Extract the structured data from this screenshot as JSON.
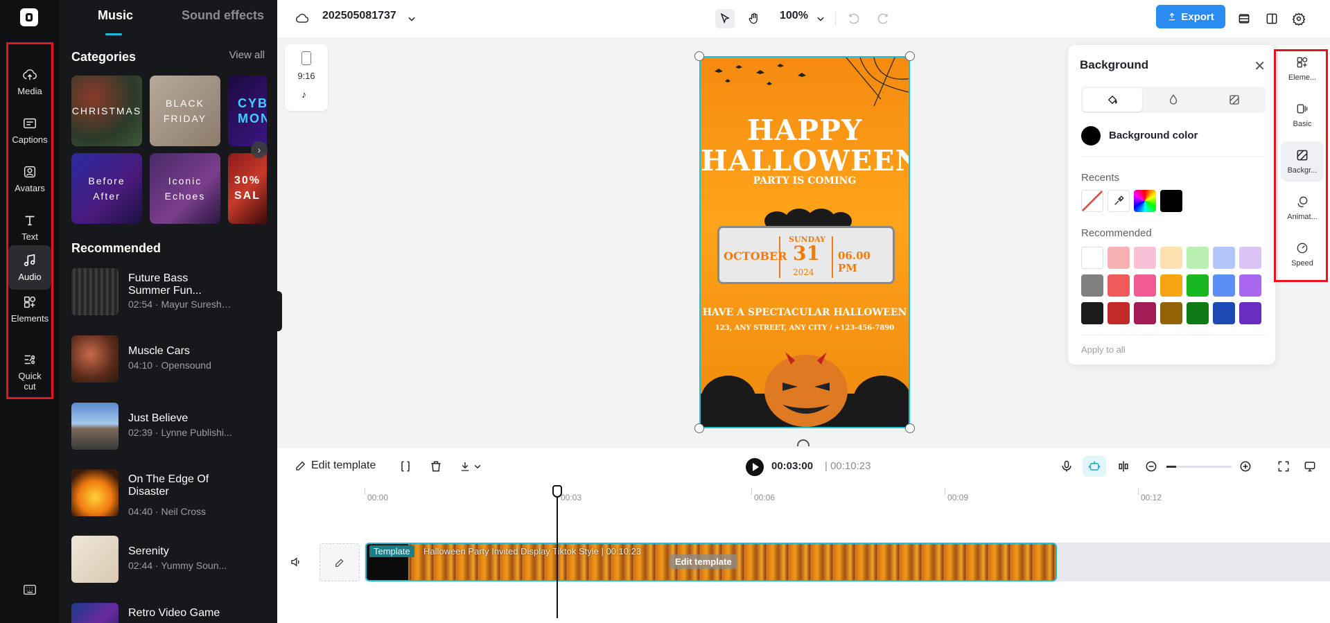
{
  "left_rail": {
    "items": [
      {
        "label": "Media",
        "icon": "cloud-upload-icon"
      },
      {
        "label": "Captions",
        "icon": "captions-icon"
      },
      {
        "label": "Avatars",
        "icon": "avatar-icon"
      },
      {
        "label": "Text",
        "icon": "text-icon"
      },
      {
        "label": "Audio",
        "icon": "music-note-icon",
        "active": true
      },
      {
        "label": "Elements",
        "icon": "elements-icon"
      },
      {
        "label": "Quick cut",
        "icon": "quick-cut-icon"
      }
    ]
  },
  "panel": {
    "tabs": [
      "Music",
      "Sound effects"
    ],
    "categories_title": "Categories",
    "view_all": "View all",
    "categories": [
      {
        "label": "CHRISTMAS"
      },
      {
        "label": "BLACK FRIDAY"
      },
      {
        "label": "CYBE MON"
      },
      {
        "label": "Before After"
      },
      {
        "label": "Iconic Echoes"
      },
      {
        "label": "30% SAL"
      }
    ],
    "recommended_title": "Recommended",
    "tracks": [
      {
        "title": "Future Bass Summer Fun...",
        "meta": "02:54 · Mayur Suresh ..."
      },
      {
        "title": "Muscle Cars",
        "meta": "04:10 · Opensound"
      },
      {
        "title": "Just Believe",
        "meta": "02:39 · Lynne Publishi..."
      },
      {
        "title": "On The Edge Of Disaster",
        "meta": "04:40 · Neil Cross"
      },
      {
        "title": "Serenity",
        "meta": "02:44 · Yummy Soun..."
      },
      {
        "title": "Retro Video Game",
        "meta": ""
      }
    ]
  },
  "topbar": {
    "project_name": "202505081737",
    "zoom": "100%",
    "export_label": "Export"
  },
  "canvas": {
    "ratio_label": "9:16",
    "poster": {
      "headline": "HAPPY HALLOWEEN",
      "subhead": "PARTY IS COMING",
      "month": "OCTOBER",
      "weekday": "SUNDAY",
      "day": "31",
      "year": "2024",
      "time": "06.00 PM",
      "tagline": "HAVE A SPECTACULAR HALLOWEEN",
      "address": "123, ANY STREET, ANY CITY / +123-456-7890"
    }
  },
  "background_panel": {
    "title": "Background",
    "color_label": "Background color",
    "recents_label": "Recents",
    "recommended_label": "Recommended",
    "apply_all": "Apply to all",
    "recent_colors": [
      "none",
      "eyedropper",
      "gradient",
      "#000000"
    ],
    "recommended_colors": [
      "#ffffff",
      "#f7b3b3",
      "#f8bfd6",
      "#fde2b0",
      "#b7f0b0",
      "#b3c8f8",
      "#dcc4f7",
      "#808080",
      "#ef5a5a",
      "#f25a94",
      "#f7a412",
      "#18b91f",
      "#5c8ef5",
      "#a866ee",
      "#1b1b1b",
      "#c22a2a",
      "#a31c55",
      "#926206",
      "#0f7a14",
      "#1c49b4",
      "#6a2ec2"
    ]
  },
  "right_rail": {
    "items": [
      {
        "label": "Eleme...",
        "icon": "elements-icon"
      },
      {
        "label": "Basic",
        "icon": "basic-icon"
      },
      {
        "label": "Backgr...",
        "icon": "background-icon",
        "active": true
      },
      {
        "label": "Animat...",
        "icon": "animation-icon"
      },
      {
        "label": "Speed",
        "icon": "speed-icon"
      }
    ]
  },
  "timeline": {
    "edit_template": "Edit template",
    "current_time": "00:03:00",
    "total_time": "| 00:10:23",
    "ticks": [
      "00:00",
      "00:03",
      "00:06",
      "00:09",
      "00:12"
    ],
    "clip_tag": "Template",
    "clip_title": "Halloween Party Invited Display Tiktok Style | 00:10:23",
    "clip_edit": "Edit template"
  }
}
